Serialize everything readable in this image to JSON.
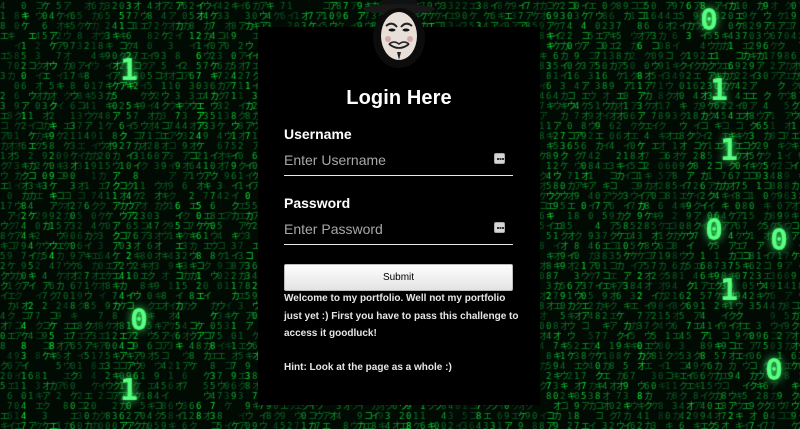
{
  "login": {
    "title": "Login Here",
    "username_label": "Username",
    "username_placeholder": "Enter Username",
    "password_label": "Password",
    "password_placeholder": "Enter Password",
    "submit_label": "Submit",
    "welcome_message": "Welcome to my portfolio. Well not my portfolio just yet :) First you have to pass this challenge to access it goodluck!",
    "hint": "Hint: Look at the page as a whole :)"
  },
  "colors": {
    "background": "#000000",
    "matrix_green": "#1ee05a",
    "text": "#ffffff"
  },
  "icons": {
    "avatar": "guy-fawkes-mask-icon",
    "field_key": "password-manager-key-icon"
  }
}
